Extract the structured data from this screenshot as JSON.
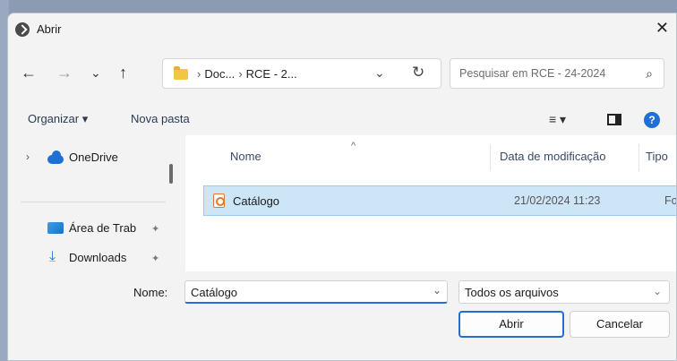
{
  "window": {
    "title": "Abrir",
    "close_glyph": "✕"
  },
  "nav": {
    "back": "←",
    "forward": "→",
    "recent": "⌄",
    "up": "↑",
    "breadcrumb": [
      "Doc...",
      "RCE - 2..."
    ],
    "breadcrumb_sep": "›",
    "address_chevron": "⌄",
    "refresh": "↻"
  },
  "search": {
    "placeholder": "Pesquisar em RCE - 24-2024",
    "icon": "⌕"
  },
  "commands": {
    "organize": "Organizar ▾",
    "new_folder": "Nova pasta",
    "view": "≡ ▾",
    "help": "?"
  },
  "sidebar": {
    "items": [
      {
        "label": "OneDrive",
        "icon": "cloud-icon",
        "chevron": "›"
      },
      {
        "label": "Área de Trab",
        "icon": "desktop-icon",
        "pin": "✦"
      },
      {
        "label": "Downloads",
        "icon": "download-icon",
        "pin": "✦"
      }
    ]
  },
  "columns": {
    "name": "Nome",
    "date": "Data de modificação",
    "type": "Tipo",
    "sort": "^"
  },
  "files": [
    {
      "name": "Catálogo",
      "date": "21/02/2024 11:23",
      "type": "Foxit"
    }
  ],
  "footer": {
    "name_label": "Nome:",
    "name_value": "Catálogo",
    "filter": "Todos os arquivos",
    "open": "Abrir",
    "cancel": "Cancelar"
  },
  "colors": {
    "accent": "#1f6fd6",
    "selection": "#cde6f7",
    "folder": "#f4c542"
  }
}
